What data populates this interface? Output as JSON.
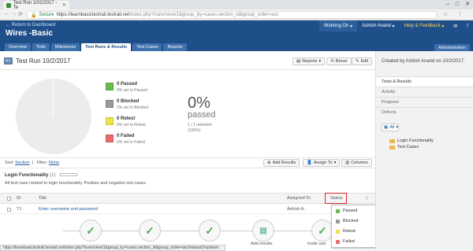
{
  "browser": {
    "tab_title": "Test Run 10/2/2017 - Te",
    "secure_label": "Secure",
    "url_prefix": "https://learnbasictestrail.testrail.net",
    "url_path": "/index.php?/runs/view/1&group_by=cases:section_id&group_order=asc"
  },
  "header": {
    "return_link": "← Return to Dashboard",
    "project_name": "Wires -Basic",
    "working_on": "Working On",
    "user": "Ashish Anand",
    "help": "Help & Feedback",
    "administration": "Administration"
  },
  "nav": {
    "tabs": [
      "Overview",
      "Todo",
      "Milestones",
      "Test Runs & Results",
      "Test Cases",
      "Reports"
    ],
    "active_index": 3
  },
  "run": {
    "badge": "R1",
    "title": "Test Run 10/2/2017",
    "reports": "Reports",
    "rerun": "Rerun",
    "edit": "Edit"
  },
  "stats": [
    {
      "label": "0 Passed",
      "sub": "0% set to Passed",
      "color": "#6cba4e"
    },
    {
      "label": "0 Blocked",
      "sub": "0% set to Blocked",
      "color": "#9a9a9a"
    },
    {
      "label": "0 Retest",
      "sub": "0% set to Retest",
      "color": "#f2e24a"
    },
    {
      "label": "0 Failed",
      "sub": "0% set to Failed",
      "color": "#ec6a6a"
    }
  ],
  "summary": {
    "percent": "0%",
    "word": "passed",
    "untested_line1": "1 / 1 untested",
    "untested_line2": "(100%)."
  },
  "toolbar": {
    "sort_label": "Sort:",
    "sort_value": "Section",
    "filter_label": "Filter:",
    "filter_value": "None",
    "add_results": "Add Results",
    "assign_to": "Assign To",
    "columns": "Columns"
  },
  "section": {
    "title": "Login Functionality",
    "count": "(1)",
    "description": "All test case related to login functionality. Positive and negative test cases"
  },
  "table": {
    "headers": {
      "id": "ID",
      "title": "Title",
      "assigned": "Assigned To",
      "status": "Status"
    },
    "rows": [
      {
        "id": "T1",
        "title": "Enter username and password",
        "assigned": "Ashish A."
      }
    ]
  },
  "status_dropdown": [
    {
      "label": "Passed",
      "color": "#6cba4e"
    },
    {
      "label": "Blocked",
      "color": "#9a9a9a"
    },
    {
      "label": "Retest",
      "color": "#f2e24a"
    },
    {
      "label": "Failed",
      "color": "#ec6a6a"
    }
  ],
  "workflow": {
    "labels": [
      "Add results",
      "Invite use"
    ],
    "check": "✓"
  },
  "statusbar": "https://learnbasictestrail.testrail.net/index.php?/runs/view/1&group_by=cases:section_id&group_order=asc#statusDropdown",
  "sidebar": {
    "created_by": "Created by Ashish Anand on 10/2/2017.",
    "items": [
      "Tests & Results",
      "Activity",
      "Progress",
      "Defects"
    ],
    "active_index": 0,
    "all_label": "All",
    "tree": [
      "Login Functionality",
      "Test Cases"
    ]
  }
}
